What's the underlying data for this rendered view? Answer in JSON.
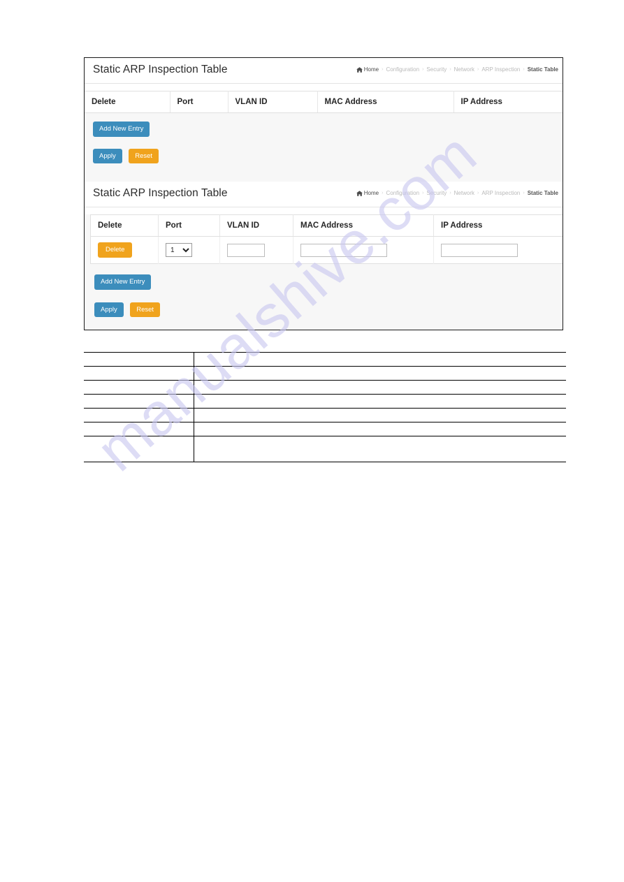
{
  "page": {
    "watermark": "manualshive.com"
  },
  "panels": [
    {
      "title": "Static ARP Inspection Table",
      "breadcrumb": {
        "home": "Home",
        "separator": "›",
        "items": [
          "Configuration",
          "Security",
          "Network",
          "ARP Inspection"
        ],
        "current": "Static Table"
      },
      "table": {
        "columns": [
          "Delete",
          "Port",
          "VLAN ID",
          "MAC Address",
          "IP Address"
        ],
        "rows": []
      },
      "buttons": {
        "add_new_entry": "Add New Entry",
        "apply": "Apply",
        "reset": "Reset"
      }
    },
    {
      "title": "Static ARP Inspection Table",
      "breadcrumb": {
        "home": "Home",
        "separator": "›",
        "items": [
          "Configuration",
          "Security",
          "Network",
          "ARP Inspection"
        ],
        "current": "Static Table"
      },
      "table": {
        "columns": [
          "Delete",
          "Port",
          "VLAN ID",
          "MAC Address",
          "IP Address"
        ],
        "rows": [
          {
            "delete_label": "Delete",
            "port_value": "1",
            "port_options": [
              "1"
            ],
            "vlan_id_value": "",
            "mac_address_value": "",
            "ip_address_value": ""
          }
        ]
      },
      "buttons": {
        "add_new_entry": "Add New Entry",
        "apply": "Apply",
        "reset": "Reset"
      }
    }
  ],
  "colors": {
    "primary_blue": "#3c8dbc",
    "accent_orange": "#f0a31d",
    "watermark": "#c9c7f0"
  },
  "doc_table": {
    "rows": [
      {
        "c1": "",
        "c2": ""
      },
      {
        "c1": "",
        "c2": ""
      },
      {
        "c1": "",
        "c2": ""
      },
      {
        "c1": "",
        "c2": ""
      },
      {
        "c1": "",
        "c2": ""
      },
      {
        "c1": "",
        "c2": ""
      },
      {
        "c1": "",
        "c2": ""
      }
    ]
  }
}
